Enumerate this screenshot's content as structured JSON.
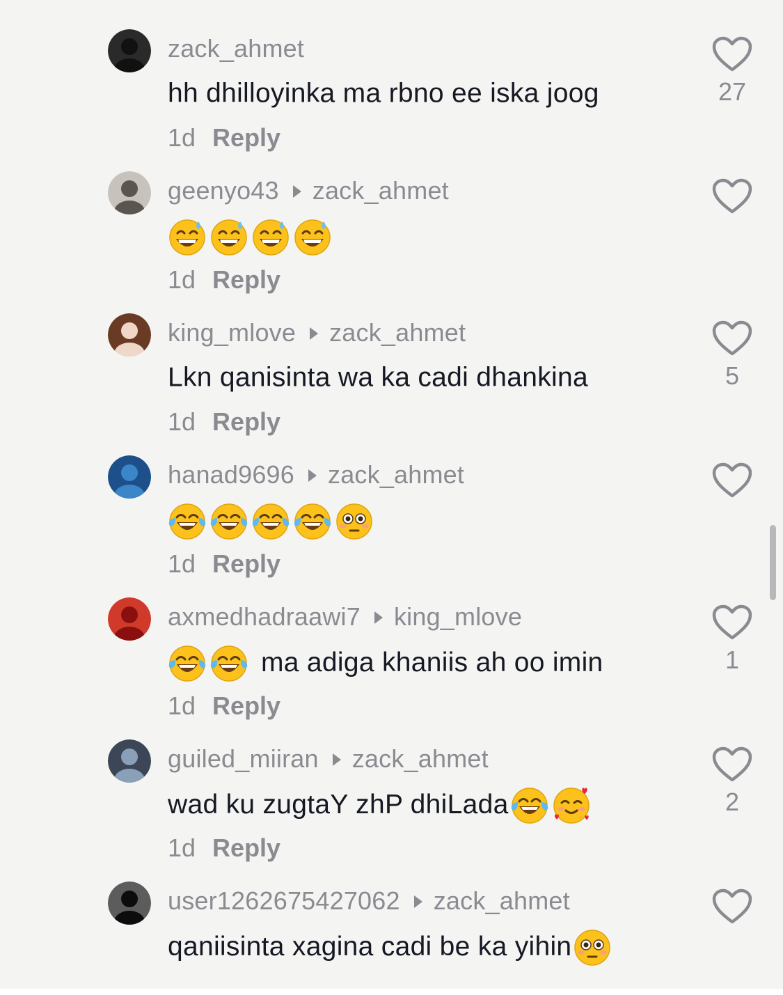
{
  "comments": [
    {
      "author": "zack_ahmet",
      "reply_to": "",
      "text": "hh dhilloyinka ma rbno ee iska joog",
      "emojis_before": [],
      "emojis_after": [],
      "time": "1d",
      "reply_label": "Reply",
      "likes": "27",
      "avatar_colors": [
        "#111111",
        "#2a2a2a"
      ]
    },
    {
      "author": "geenyo43",
      "reply_to": "zack_ahmet",
      "text": "",
      "emojis_before": [
        "grinning-sweat-emoji",
        "grinning-sweat-emoji",
        "grinning-sweat-emoji",
        "grinning-sweat-emoji"
      ],
      "emojis_after": [],
      "time": "1d",
      "reply_label": "Reply",
      "likes": "",
      "avatar_colors": [
        "#5a5550",
        "#c7c2bb"
      ]
    },
    {
      "author": "king_mlove",
      "reply_to": "zack_ahmet",
      "text": "Lkn qanisinta wa ka cadi dhankina",
      "emojis_before": [],
      "emojis_after": [],
      "time": "1d",
      "reply_label": "Reply",
      "likes": "5",
      "avatar_colors": [
        "#f0d8c8",
        "#6a3b24"
      ]
    },
    {
      "author": "hanad9696",
      "reply_to": "zack_ahmet",
      "text": "",
      "emojis_before": [
        "tears-of-joy-emoji",
        "tears-of-joy-emoji",
        "tears-of-joy-emoji",
        "tears-of-joy-emoji",
        "flushed-emoji"
      ],
      "emojis_after": [],
      "time": "1d",
      "reply_label": "Reply",
      "likes": "",
      "avatar_colors": [
        "#3a86c8",
        "#1d4f8a"
      ]
    },
    {
      "author": "axmedhadraawi7",
      "reply_to": "king_mlove",
      "text": "ma adiga khaniis ah oo imin",
      "emojis_before": [
        "tears-of-joy-emoji",
        "tears-of-joy-emoji"
      ],
      "emojis_after": [],
      "time": "1d",
      "reply_label": "Reply",
      "likes": "1",
      "avatar_colors": [
        "#8a1010",
        "#d03a2a"
      ]
    },
    {
      "author": "guiled_miiran",
      "reply_to": "zack_ahmet",
      "text": "wad ku zugtaY zhP dhiLada",
      "emojis_before": [],
      "emojis_after": [
        "tears-of-joy-emoji",
        "smiling-hearts-emoji"
      ],
      "time": "1d",
      "reply_label": "Reply",
      "likes": "2",
      "avatar_colors": [
        "#8aa0b8",
        "#3c4656"
      ]
    },
    {
      "author": "user1262675427062",
      "reply_to": "zack_ahmet",
      "text": "qaniisinta xagina cadi be ka yihin",
      "emojis_before": [],
      "emojis_after": [
        "flushed-emoji"
      ],
      "time": "",
      "reply_label": "",
      "likes": "",
      "avatar_colors": [
        "#0c0c0c",
        "#5c5c5c"
      ]
    }
  ],
  "colors": {
    "background": "#f4f4f3",
    "secondary_text": "#8a8b91",
    "primary_text": "#161823",
    "emoji_yellow": "#fcc21b"
  }
}
